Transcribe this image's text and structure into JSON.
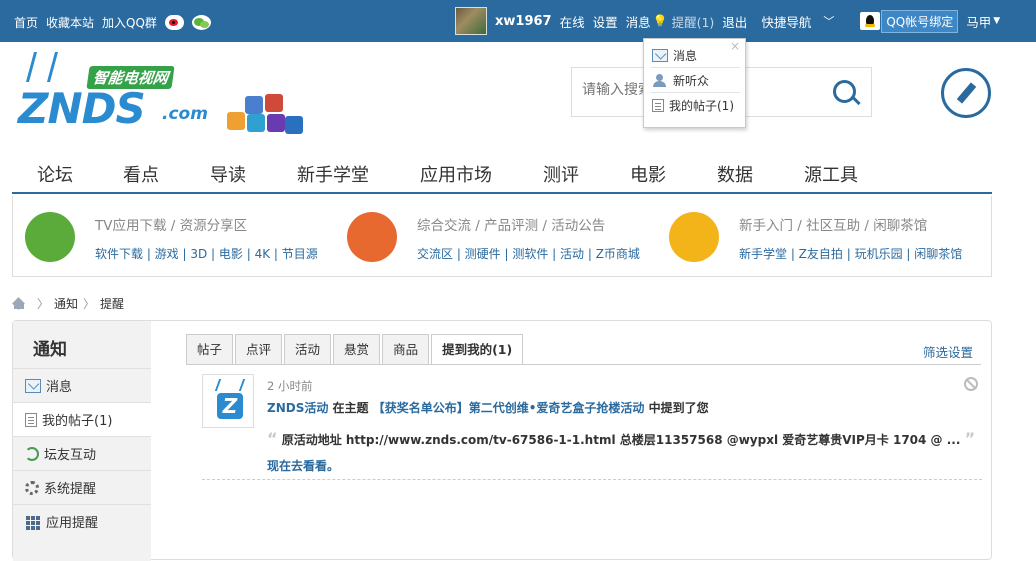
{
  "topbar": {
    "left_links": [
      "首页",
      "收藏本站",
      "加入QQ群"
    ],
    "username": "xw1967",
    "status": "在线",
    "settings": "设置",
    "messages": "消息",
    "reminder": "提醒(1)",
    "logout": "退出",
    "quick_nav": "快捷导航",
    "qq_bind": "QQ帐号绑定",
    "user_menu": "马甲"
  },
  "popup": {
    "items": [
      "消息",
      "新听众",
      "我的帖子(1)"
    ],
    "close": "×"
  },
  "logo": {
    "brand": "ZNDS",
    "domain": ".com",
    "subtitle": "智能电视网"
  },
  "search": {
    "placeholder": "请输入搜索内容"
  },
  "mainnav": [
    "论坛",
    "看点",
    "导读",
    "新手学堂",
    "应用市场",
    "测评",
    "电影",
    "数据",
    "源工具"
  ],
  "categories": [
    {
      "title": "TV应用下载 / 资源分享区",
      "links": "软件下载 | 游戏 | 3D | 电影 | 4K | 节目源",
      "color": "#5aab3a"
    },
    {
      "title": "综合交流 / 产品评测 / 活动公告",
      "links": "交流区 | 测硬件 | 测软件 | 活动 | Z币商城",
      "color": "#e8692f"
    },
    {
      "title": "新手入门 / 社区互助 / 闲聊茶馆",
      "links": "新手学堂 | Z友自拍 | 玩机乐园 | 闲聊茶馆",
      "color": "#f2b419"
    }
  ],
  "breadcrumb": [
    "通知",
    "提醒"
  ],
  "sidebar": {
    "title": "通知",
    "items": [
      "消息",
      "我的帖子(1)",
      "坛友互动",
      "系统提醒",
      "应用提醒"
    ]
  },
  "tabs": [
    "帖子",
    "点评",
    "活动",
    "悬赏",
    "商品",
    "提到我的(1)"
  ],
  "filter": "筛选设置",
  "notification": {
    "time": "2 小时前",
    "actor": "ZNDS活动",
    "in_topic": " 在主题 ",
    "topic": "【获奖名单公布】第二代创维•爱奇艺盒子抢楼活动",
    "mentioned": " 中提到了您",
    "quote": "原活动地址 http://www.znds.com/tv-67586-1-1.html 总楼层11357568 @wypxl 爱奇艺尊贵VIP月卡 1704 @ ...",
    "go": "现在去看看。"
  }
}
